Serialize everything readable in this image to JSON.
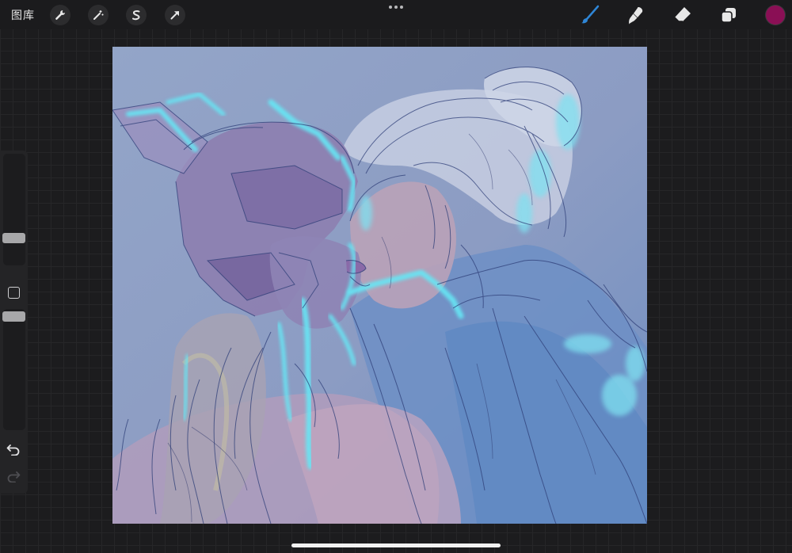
{
  "topbar": {
    "gallery_label": "图库",
    "left_tools": [
      {
        "name": "actions-wrench-icon"
      },
      {
        "name": "adjustments-magic-wand-icon"
      },
      {
        "name": "selection-s-icon"
      },
      {
        "name": "transform-arrow-icon"
      }
    ],
    "right_tools": [
      {
        "name": "brush-icon",
        "active_color": "#2f86d6"
      },
      {
        "name": "smudge-icon"
      },
      {
        "name": "eraser-icon"
      },
      {
        "name": "layers-icon"
      }
    ],
    "current_color": "#8a0f55"
  },
  "sidebar": {
    "size_slider_level": 0.22,
    "opacity_slider_level": 0.98,
    "modify_button": "square-modify-icon",
    "undo": "undo-icon",
    "redo": "redo-icon"
  },
  "canvas": {
    "background_color": "#8ea0c4",
    "glow_color": "#66e6f4",
    "artwork": "sketch-painting"
  }
}
